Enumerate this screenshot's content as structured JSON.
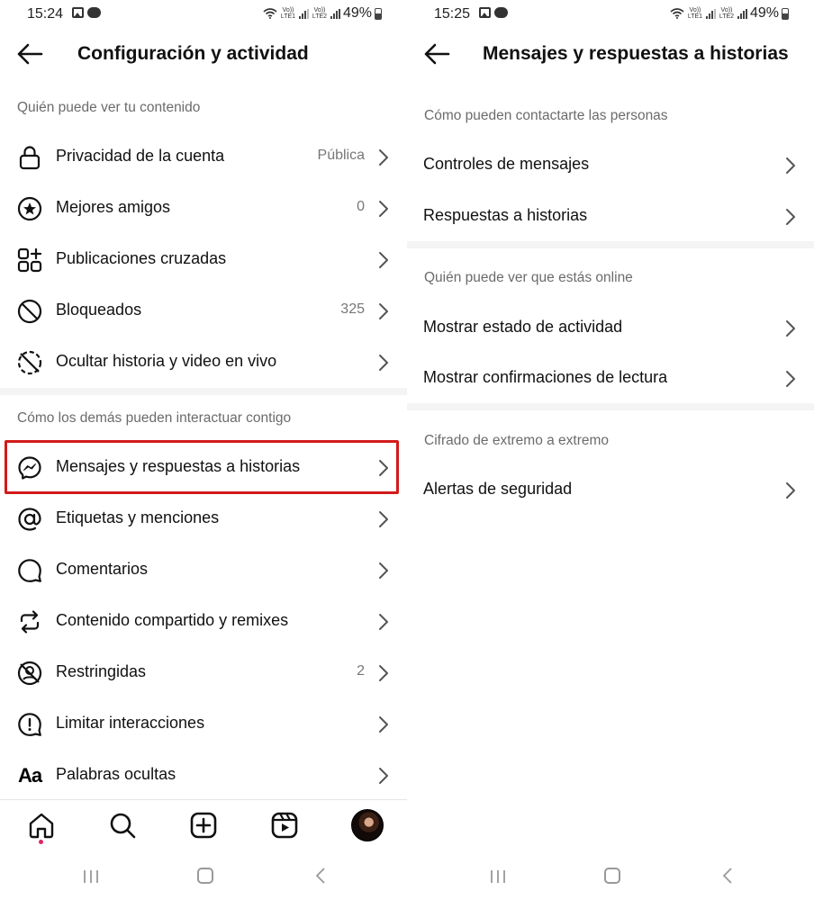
{
  "left": {
    "status": {
      "time": "15:24",
      "sim1": "Vo)) LTE1",
      "sim2": "Vo)) LTE2",
      "battery": "49%"
    },
    "header": {
      "title": "Configuración y actividad"
    },
    "section1": {
      "title": "Quién puede ver tu contenido",
      "items": [
        {
          "label": "Privacidad de la cuenta",
          "value": "Pública",
          "icon": "lock-icon"
        },
        {
          "label": "Mejores amigos",
          "value": "0",
          "icon": "star-circle-icon"
        },
        {
          "label": "Publicaciones cruzadas",
          "value": "",
          "icon": "grid-plus-icon"
        },
        {
          "label": "Bloqueados",
          "value": "325",
          "icon": "blocked-icon"
        },
        {
          "label": "Ocultar historia y video en vivo",
          "value": "",
          "icon": "hide-story-icon"
        }
      ]
    },
    "section2": {
      "title": "Cómo los demás pueden interactuar contigo",
      "items": [
        {
          "label": "Mensajes y respuestas a historias",
          "value": "",
          "icon": "messenger-icon"
        },
        {
          "label": "Etiquetas y menciones",
          "value": "",
          "icon": "at-icon"
        },
        {
          "label": "Comentarios",
          "value": "",
          "icon": "comment-icon"
        },
        {
          "label": "Contenido compartido y remixes",
          "value": "",
          "icon": "remix-icon"
        },
        {
          "label": "Restringidas",
          "value": "2",
          "icon": "restricted-icon"
        },
        {
          "label": "Limitar interacciones",
          "value": "",
          "icon": "limit-icon"
        },
        {
          "label": "Palabras ocultas",
          "value": "",
          "icon": "text-icon"
        }
      ]
    },
    "hidden_words_glyph": "Aa",
    "highlight_color": "#d21a1a"
  },
  "right": {
    "status": {
      "time": "15:25",
      "sim1": "Vo)) LTE1",
      "sim2": "Vo)) LTE2",
      "battery": "49%"
    },
    "header": {
      "title": "Mensajes y respuestas a historias"
    },
    "section1": {
      "title": "Cómo pueden contactarte las personas",
      "items": [
        {
          "label": "Controles de mensajes"
        },
        {
          "label": "Respuestas a historias"
        }
      ]
    },
    "section2": {
      "title": "Quién puede ver que estás online",
      "items": [
        {
          "label": "Mostrar estado de actividad"
        },
        {
          "label": "Mostrar confirmaciones de lectura"
        }
      ]
    },
    "section3": {
      "title": "Cifrado de extremo a extremo",
      "items": [
        {
          "label": "Alertas de seguridad"
        }
      ]
    }
  }
}
